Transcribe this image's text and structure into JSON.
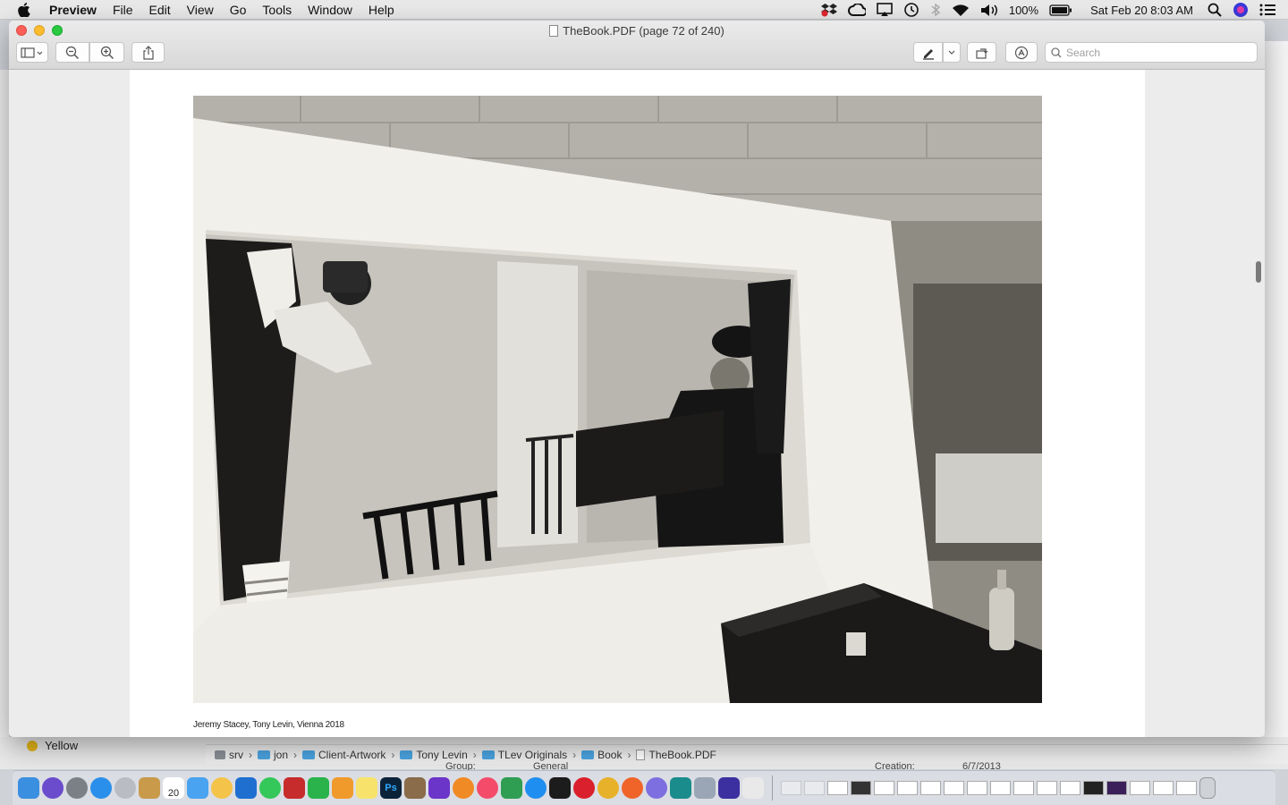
{
  "menubar": {
    "app_name": "Preview",
    "menus": [
      "File",
      "Edit",
      "View",
      "Go",
      "Tools",
      "Window",
      "Help"
    ],
    "battery": "100%",
    "datetime": "Sat Feb 20  8:03 AM"
  },
  "window": {
    "title": "TheBook.PDF (page 72 of 240)",
    "search_placeholder": "Search"
  },
  "page": {
    "caption": "Jeremy Stacey, Tony Levin, Vienna 2018"
  },
  "finder": {
    "tag_label": "Yellow",
    "path": [
      "srv",
      "jon",
      "Client-Artwork",
      "Tony Levin",
      "TLev Originals",
      "Book",
      "TheBook.PDF"
    ],
    "ghost_left": "Group:",
    "ghost_mid": "General",
    "ghost_right": "Creation:",
    "ghost_date": "6/7/2013"
  },
  "dock": {
    "calendar_day": "20",
    "colors": {
      "finder": "#3b8fe0",
      "siri": "#6a4ccc",
      "settings": "#7b7f86",
      "safari": "#2a8fea",
      "rocket": "#b9bcc2",
      "notes": "#c89a4a",
      "calendar": "#ffffff",
      "mail": "#4aa3f0",
      "photos": "#f3c34a",
      "xcode": "#1f6fd1",
      "messages": "#34c759",
      "photobooth": "#c72c2c",
      "numbers": "#29b34a",
      "pages": "#f09a2c",
      "stickies": "#f7e26b",
      "photoshop": "#0b2339",
      "script": "#8a6b4a",
      "imovie": "#6c35c9",
      "books": "#f08a24",
      "music": "#f54b6a",
      "instruments": "#2f9e52",
      "appstore": "#1e8ef0",
      "terminal": "#1c1c1c",
      "opera": "#d9202c",
      "chrome": "#e8b12a",
      "firefox": "#f0642a",
      "bbedit": "#7e6fe0",
      "affinity": "#1a8c8c",
      "preview": "#9aa6b5",
      "amazon": "#3c2fa0",
      "textedit": "#e9e9e9"
    }
  }
}
